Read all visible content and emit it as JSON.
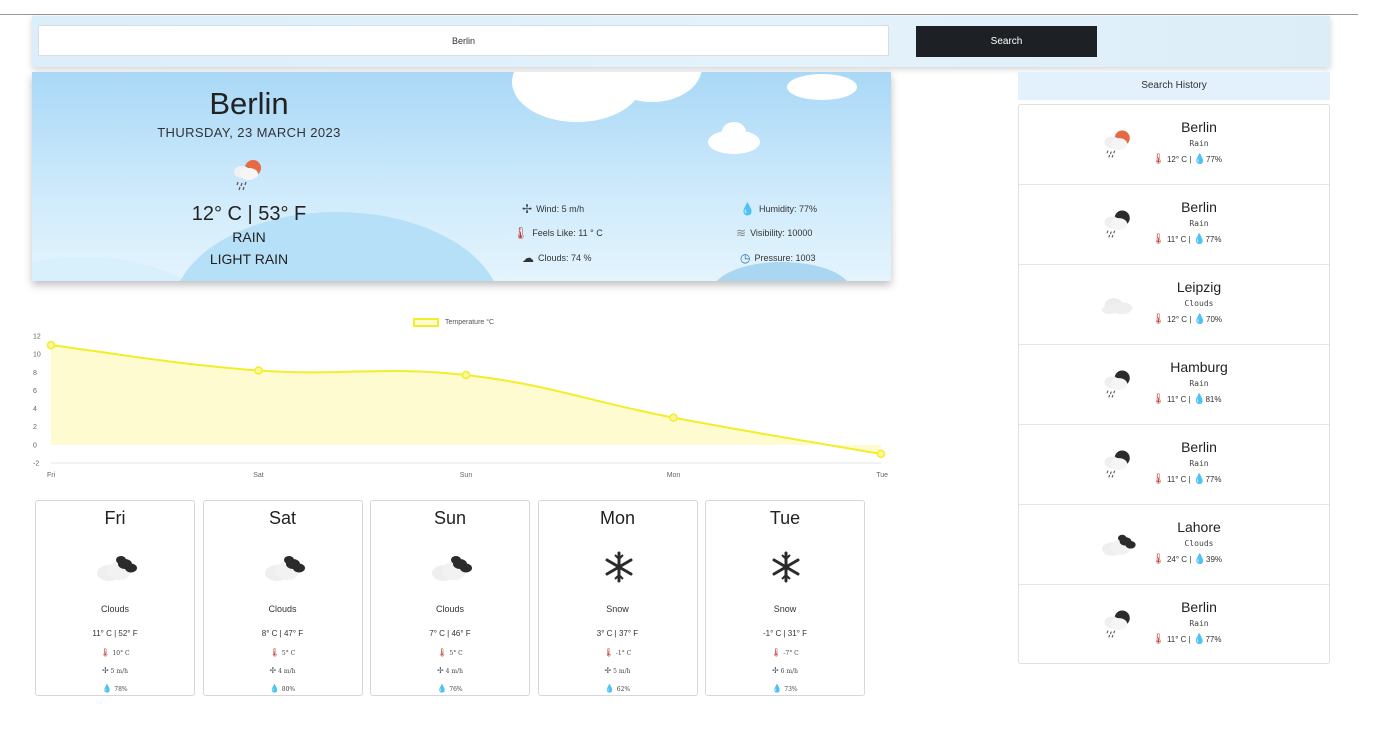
{
  "search": {
    "value": "Berlin",
    "button_label": "Search"
  },
  "current": {
    "city": "Berlin",
    "date": "THURSDAY, 23 MARCH 2023",
    "temperature": "12° C | 53° F",
    "condition": "RAIN",
    "description": "LIGHT RAIN",
    "wind": "Wind: 5 m/h",
    "feels_like": "Feels Like: 11 ° C",
    "clouds": "Clouds: 74 %",
    "humidity": "Humidity: 77%",
    "visibility": "Visibility: 10000",
    "pressure": "Pressure: 1003",
    "icon": "rain-sun-icon"
  },
  "chart_data": {
    "type": "line",
    "categories": [
      "Fri",
      "Sat",
      "Sun",
      "Mon",
      "Tue"
    ],
    "series": [
      {
        "name": "Temperature °C",
        "values": [
          11,
          8.2,
          7.7,
          3,
          -1
        ]
      }
    ],
    "yticks": [
      "12",
      "10",
      "8",
      "6",
      "4",
      "2",
      "0",
      "-2"
    ],
    "ylim": [
      -2,
      12
    ],
    "fill": true,
    "line_color": "#f2ee2a",
    "legend": "top"
  },
  "forecast": [
    {
      "day": "Fri",
      "icon": "clouds-icon",
      "condition": "Clouds",
      "temp": "11° C | 52° F",
      "feels": "10° C",
      "wind": "5 m/h",
      "humidity": "78%"
    },
    {
      "day": "Sat",
      "icon": "clouds-icon",
      "condition": "Clouds",
      "temp": "8° C | 47° F",
      "feels": "5° C",
      "wind": "4 m/h",
      "humidity": "80%"
    },
    {
      "day": "Sun",
      "icon": "clouds-icon",
      "condition": "Clouds",
      "temp": "7° C | 46° F",
      "feels": "5° C",
      "wind": "4 m/h",
      "humidity": "76%"
    },
    {
      "day": "Mon",
      "icon": "snowflake-icon",
      "condition": "Snow",
      "temp": "3° C | 37° F",
      "feels": "-1° C",
      "wind": "5 m/h",
      "humidity": "62%"
    },
    {
      "day": "Tue",
      "icon": "snowflake-icon",
      "condition": "Snow",
      "temp": "-1° C | 31° F",
      "feels": "-7° C",
      "wind": "6 m/h",
      "humidity": "73%"
    }
  ],
  "history": {
    "title": "Search History",
    "items": [
      {
        "city": "Berlin",
        "condition": "Rain",
        "temp": "12° C |",
        "humidity": "77%",
        "icon": "rain-sun-icon"
      },
      {
        "city": "Berlin",
        "condition": "Rain",
        "temp": "11° C |",
        "humidity": "77%",
        "icon": "rain-moon-icon"
      },
      {
        "city": "Leipzig",
        "condition": "Clouds",
        "temp": "12° C |",
        "humidity": "70%",
        "icon": "cloud-icon"
      },
      {
        "city": "Hamburg",
        "condition": "Rain",
        "temp": "11° C |",
        "humidity": "81%",
        "icon": "rain-moon-icon"
      },
      {
        "city": "Berlin",
        "condition": "Rain",
        "temp": "11° C |",
        "humidity": "77%",
        "icon": "rain-moon-icon"
      },
      {
        "city": "Lahore",
        "condition": "Clouds",
        "temp": "24° C |",
        "humidity": "39%",
        "icon": "clouds-icon"
      },
      {
        "city": "Berlin",
        "condition": "Rain",
        "temp": "11° C |",
        "humidity": "77%",
        "icon": "rain-moon-icon"
      }
    ]
  }
}
